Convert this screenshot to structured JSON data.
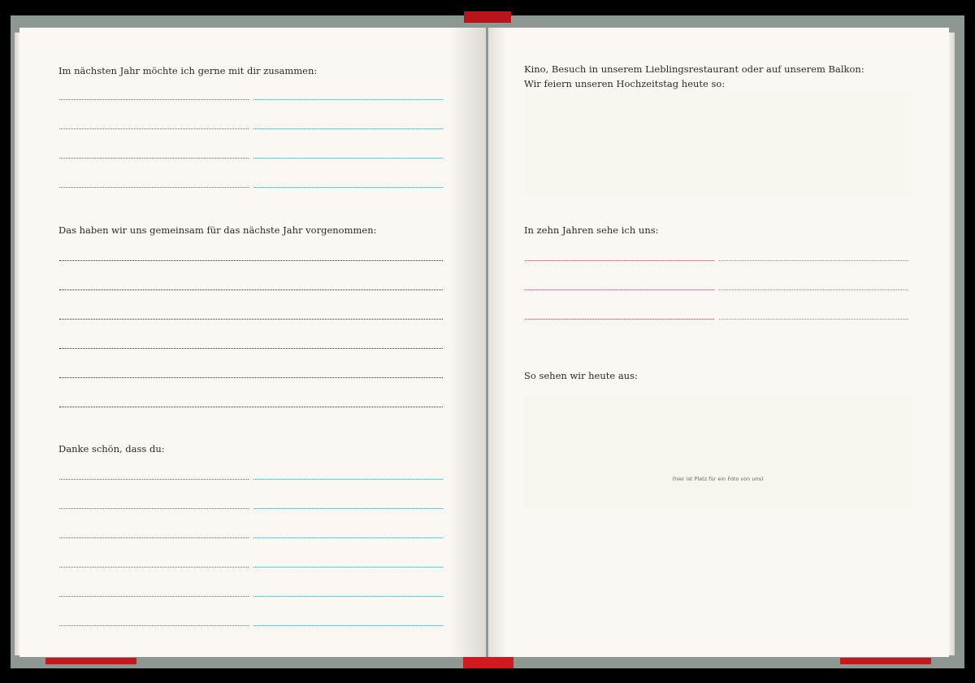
{
  "left_page": {
    "section1": {
      "heading": "Im nächsten Jahr möchte ich gerne mit dir zusammen:"
    },
    "section2": {
      "heading": "Das haben wir uns gemeinsam für das nächste Jahr vorgenommen:"
    },
    "section3": {
      "heading": "Danke schön, dass du:"
    }
  },
  "right_page": {
    "celebrate": {
      "line1": "Kino, Besuch in unserem Lieblingsrestaurant oder auf unserem Balkon:",
      "line2": "Wir feiern unseren Hochzeitstag heute so:"
    },
    "future": {
      "heading": "In zehn Jahren sehe ich uns:"
    },
    "photo": {
      "heading": "So sehen wir heute aus:",
      "caption": "(hier ist Platz für ein Foto von uns)"
    }
  },
  "colors": {
    "ribbon": "#c8161d",
    "partner_a_line": "#d23a5e",
    "partner_b_line": "#1fb7c8",
    "shared_line": "#2e2e2e",
    "paper": "#fbf8f3",
    "cover": "#8e9893"
  }
}
